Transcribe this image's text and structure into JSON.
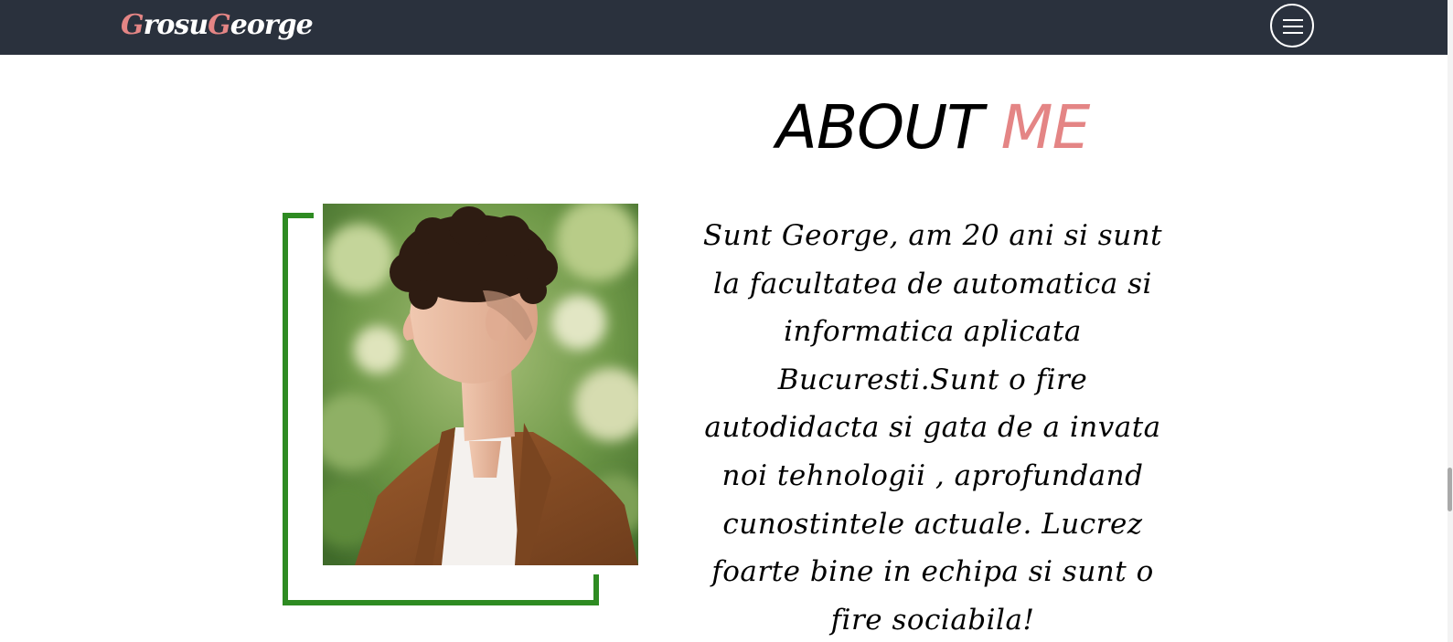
{
  "navbar": {
    "logo_part1": "G",
    "logo_part2": "rosu",
    "logo_part3": "G",
    "logo_part4": "eorge",
    "menu_icon": "hamburger-menu-icon",
    "background_color": "#2a313d",
    "accent_color": "#e48585"
  },
  "about": {
    "title_part1": "ABOUT ",
    "title_part2": "ME",
    "description": "Sunt George, am 20 ani si sunt la facultatea de automatica si informatica aplicata Bucuresti.Sunt o fire autodidacta si gata de a invata noi tehnologii , aprofundand cunostintele actuale. Lucrez foarte bine in echipa si sunt o fire sociabila!",
    "frame_color": "#2e8b22"
  }
}
